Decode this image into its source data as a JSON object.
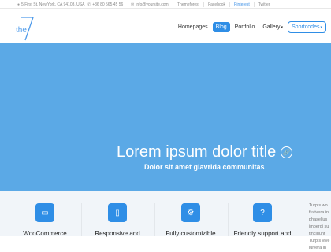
{
  "topbar": {
    "address": "5 First St, NewYork, CA 94103, USA",
    "phone": "+36 80 565 45 56",
    "email": "info@yoursite.com",
    "links": [
      "Themeforest",
      "Facebook",
      "Pinterest",
      "Twitter"
    ],
    "active_link": "Pinterest"
  },
  "logo": {
    "text": "the"
  },
  "nav": {
    "items": [
      "Homepages",
      "Blog",
      "Portfolio",
      "Gallery",
      "Shortcodes"
    ]
  },
  "hero": {
    "title": "Lorem ipsum dolor title",
    "subtitle": "Dolor sit amet glavrida communitas"
  },
  "features": [
    {
      "icon": "credit-card-icon",
      "label": "WooCommerce"
    },
    {
      "icon": "mobile-icon",
      "label": "Responsive and"
    },
    {
      "icon": "gear-icon",
      "label": "Fully customizible"
    },
    {
      "icon": "chat-icon",
      "label": "Friendly support and"
    }
  ],
  "side": {
    "lines": [
      "Turpis wo",
      "fuvivera in",
      "phasellus",
      "imperdi su",
      "tincidunt",
      "Turpis vive",
      "luivera in"
    ]
  },
  "colors": {
    "accent": "#2f8ee6",
    "hero": "#5ba9e6"
  }
}
